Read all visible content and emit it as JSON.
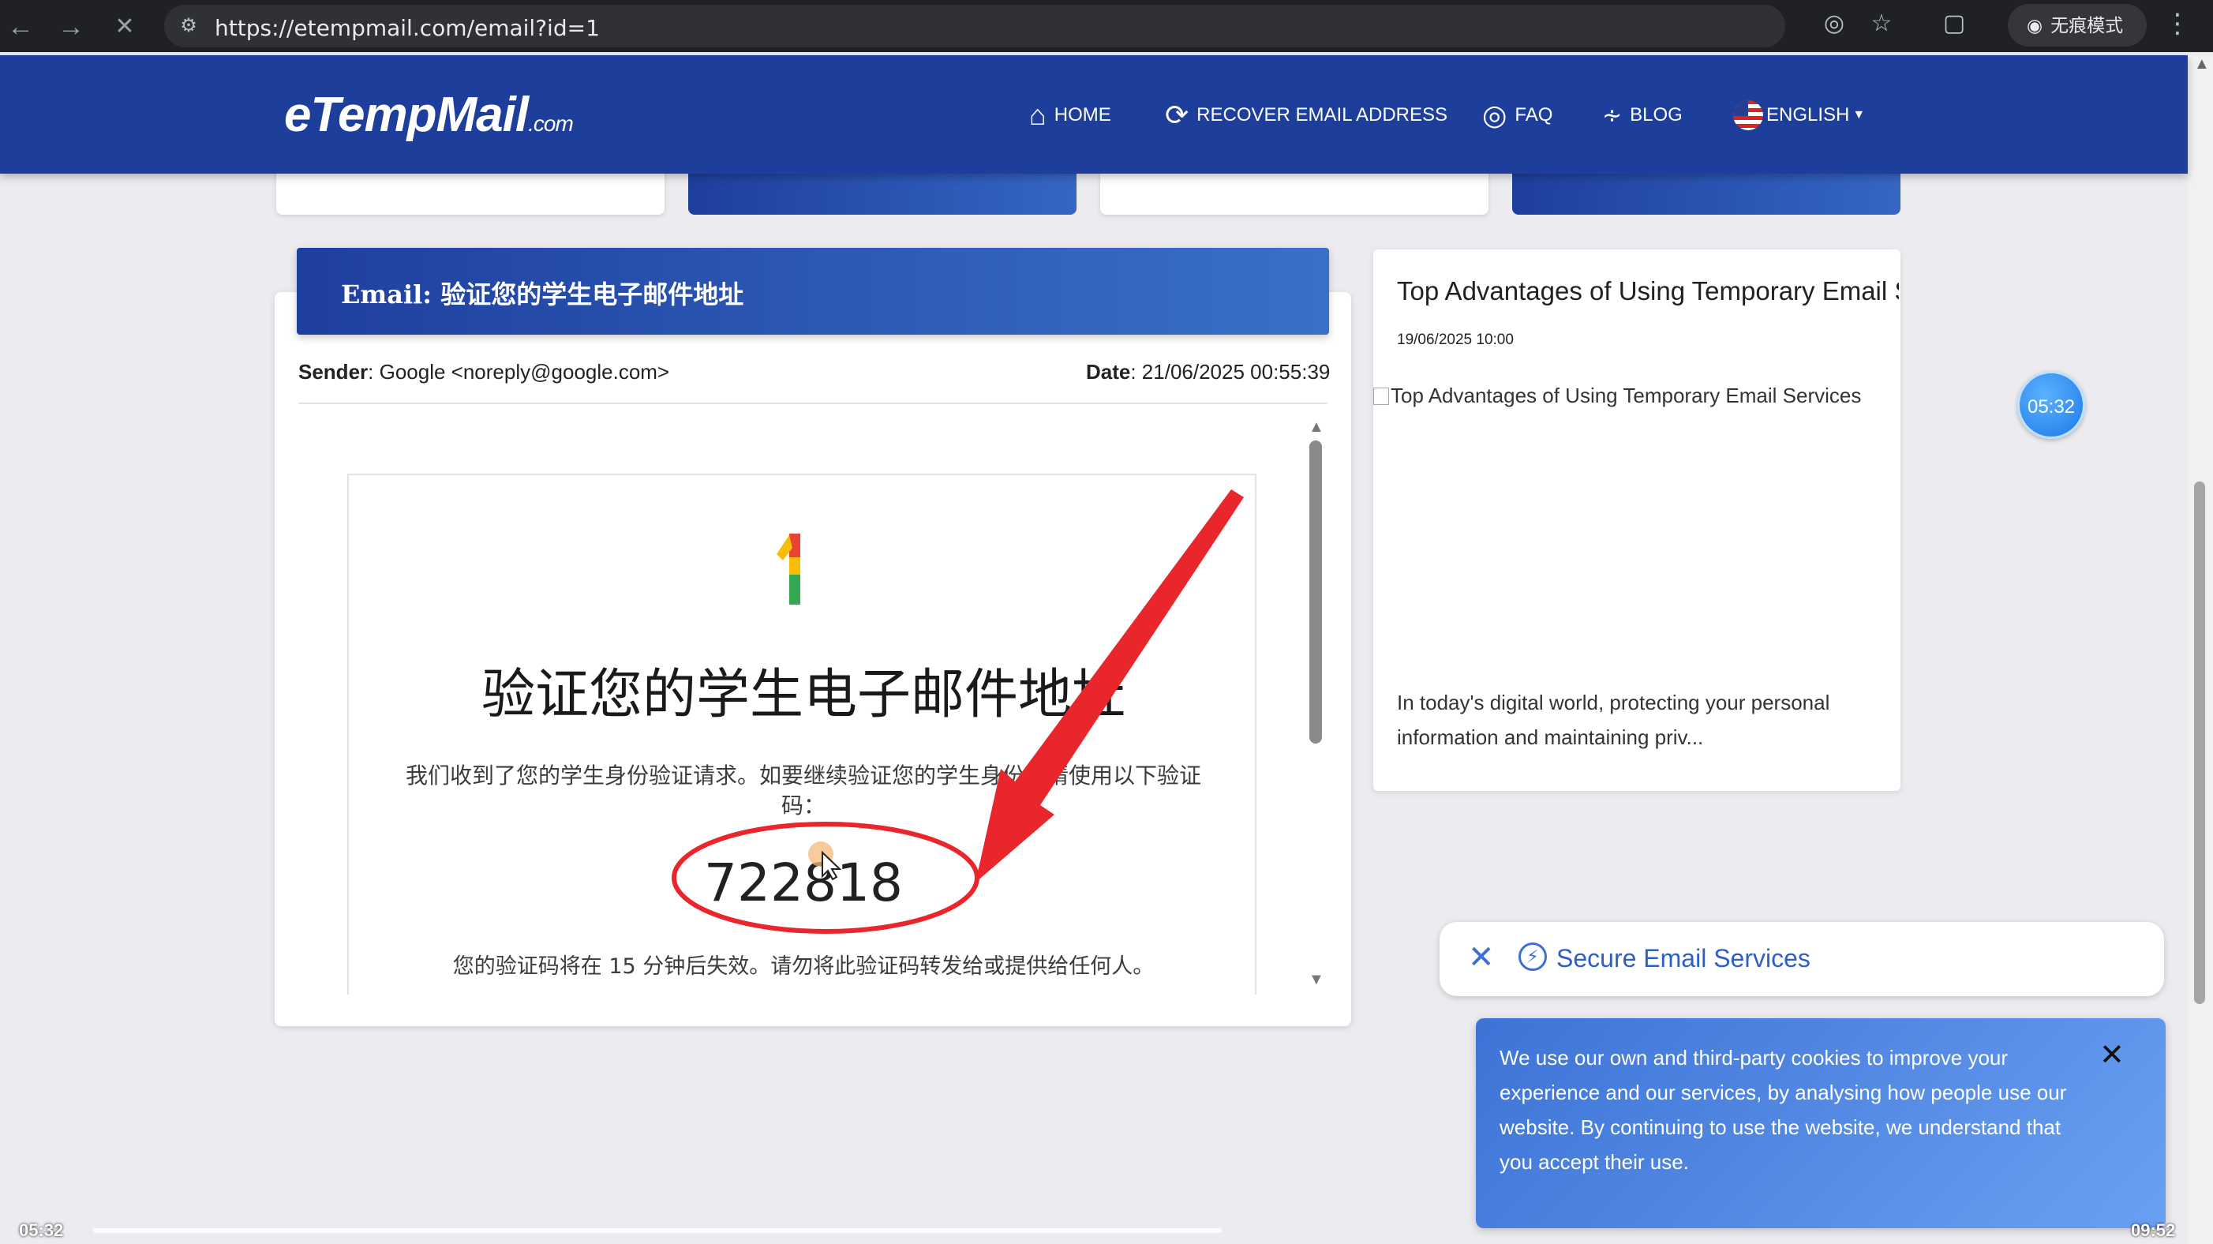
{
  "browser": {
    "url": "https://etempmail.com/email?id=1",
    "incognito_label": "无痕模式"
  },
  "site": {
    "logo_main": "eTempMail",
    "logo_suffix": ".com",
    "nav": {
      "home": "HOME",
      "recover": "RECOVER EMAIL ADDRESS",
      "faq": "FAQ",
      "blog": "BLOG",
      "language": "ENGLISH"
    }
  },
  "email": {
    "title": "Email: 验证您的学生电子邮件地址",
    "sender_label": "Sender",
    "sender_value": ": Google <noreply@google.com>",
    "date_label": "Date",
    "date_value": ": 21/06/2025 00:55:39",
    "body": {
      "headline": "验证您的学生电子邮件地址",
      "paragraph": "我们收到了您的学生身份验证请求。如要继续验证您的学生身份，请使用以下验证码：",
      "code": "722818",
      "expiry": "您的验证码将在 15 分钟后失效。请勿将此验证码转发给或提供给任何人。"
    }
  },
  "blog_card": {
    "title": "Top Advantages of Using Temporary Email Services",
    "date": "19/06/2025 10:00",
    "image_alt": "Top Advantages of Using Temporary Email Services",
    "excerpt": "In today's digital world, protecting your personal information and maintaining priv..."
  },
  "timer": "05:32",
  "secure_pill": {
    "label": "Secure Email Services"
  },
  "cookie_banner": {
    "text": "We use our own and third-party cookies to improve your experience and our services, by analysing how people use our website. By continuing to use the website, we understand that you accept their use."
  },
  "video": {
    "elapsed": "05:32",
    "total": "09:52"
  },
  "colors": {
    "header_blue": "#1e3e9c",
    "accent_blue": "#3b6fd6",
    "annotation_red": "#e8262b"
  }
}
